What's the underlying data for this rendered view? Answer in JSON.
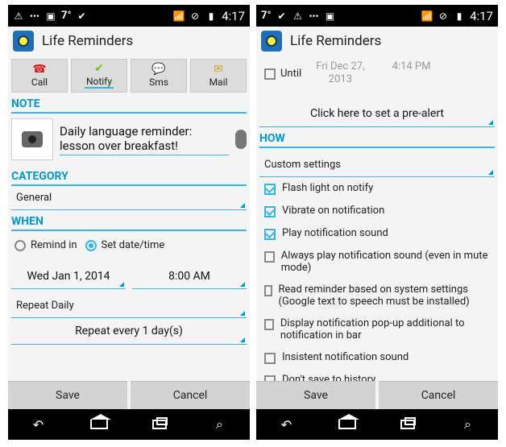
{
  "status": {
    "left_icons": [
      "warning-icon",
      "dots-icon",
      "image-icon",
      "temp-icon",
      "check-icon"
    ],
    "temp": "7°",
    "time": "4:17"
  },
  "app": {
    "title": "Life Reminders"
  },
  "left": {
    "tabs": [
      {
        "label": "Call",
        "icon": "phone-icon"
      },
      {
        "label": "Notify",
        "icon": "check-icon"
      },
      {
        "label": "Sms",
        "icon": "sms-icon"
      },
      {
        "label": "Mail",
        "icon": "mail-icon"
      }
    ],
    "note": {
      "section": "NOTE",
      "text": "Daily language reminder: lesson over breakfast!"
    },
    "category": {
      "section": "CATEGORY",
      "value": "General"
    },
    "when": {
      "section": "WHEN",
      "radio1": "Remind in",
      "radio2": "Set date/time",
      "date": "Wed Jan 1, 2014",
      "time": "8:00 AM",
      "repeat": "Repeat Daily",
      "repeat_every": "Repeat every 1 day(s)"
    },
    "buttons": {
      "save": "Save",
      "cancel": "Cancel"
    }
  },
  "right": {
    "until": {
      "label": "Until",
      "date_line1": "Fri Dec 27,",
      "date_line2": "2013",
      "time": "4:14 PM"
    },
    "prealert": "Click here to set a pre-alert",
    "how": {
      "section": "HOW",
      "custom": "Custom settings",
      "options": [
        {
          "label": "Flash light on notify",
          "checked": true
        },
        {
          "label": "Vibrate on notification",
          "checked": true
        },
        {
          "label": "Play notification sound",
          "checked": true
        },
        {
          "label": "Always play notification sound (even in mute mode)",
          "checked": false
        },
        {
          "label": "Read reminder based on system settings (Google text to speech must be installed)",
          "checked": false
        },
        {
          "label": "Display notification pop-up additional to notification in bar",
          "checked": false
        },
        {
          "label": "Insistent notification sound",
          "checked": false
        },
        {
          "label": "Don't save to history",
          "checked": false
        }
      ]
    },
    "buttons": {
      "save": "Save",
      "cancel": "Cancel"
    }
  }
}
